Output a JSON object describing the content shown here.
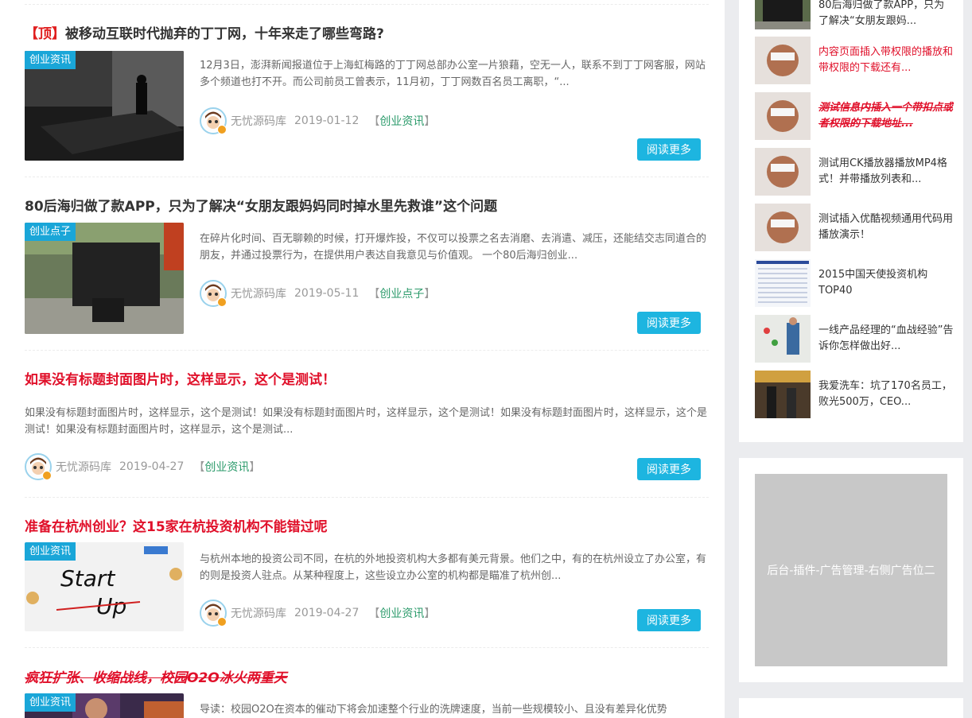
{
  "posts": [
    {
      "title_prefix": "【顶】",
      "title": "被移动互联时代抛弃的丁丁网，十年来走了哪些弯路?",
      "badge": "创业资讯",
      "excerpt": "12月3日，澎湃新闻报道位于上海虹梅路的丁丁网总部办公室一片狼藉，空无一人，联系不到丁丁网客服，网站多个频道也打不开。而公司前员工曾表示，11月初，丁丁网数百名员工离职，“...",
      "author": "无忧源码库",
      "date": "2019-01-12",
      "category_open": "【",
      "category": "创业资讯",
      "category_close": "】",
      "more": "阅读更多"
    },
    {
      "title": "80后海归做了款APP，只为了解决“女朋友跟妈妈同时掉水里先救谁”这个问题",
      "badge": "创业点子",
      "excerpt": "在碎片化时间、百无聊赖的时候，打开爆炸投，不仅可以投票之名去消磨、去消遣、减压，还能结交志同道合的朋友，并通过投票行为，在提供用户表达自我意见与价值观。 一个80后海归创业...",
      "author": "无忧源码库",
      "date": "2019-05-11",
      "category_open": "【",
      "category": "创业点子",
      "category_close": "】",
      "more": "阅读更多"
    },
    {
      "title": "如果没有标题封面图片时，这样显示，这个是测试！",
      "excerpt": "如果没有标题封面图片时，这样显示，这个是测试！如果没有标题封面图片时，这样显示，这个是测试！如果没有标题封面图片时，这样显示，这个是测试！如果没有标题封面图片时，这样显示，这个是测试...",
      "author": "无忧源码库",
      "date": "2019-04-27",
      "category_open": "【",
      "category": "创业资讯",
      "category_close": "】",
      "more": "阅读更多"
    },
    {
      "title": "准备在杭州创业？这15家在杭投资机构不能错过呢",
      "badge": "创业资讯",
      "excerpt": "与杭州本地的投资公司不同，在杭的外地投资机构大多都有美元背景。他们之中，有的在杭州设立了办公室，有的则是投资人驻点。从某种程度上，这些设立办公室的机构都是瞄准了杭州创...",
      "author": "无忧源码库",
      "date": "2019-04-27",
      "category_open": "【",
      "category": "创业资讯",
      "category_close": "】",
      "more": "阅读更多"
    },
    {
      "title": "疯狂扩张、收缩战线，校园O2O冰火两重天",
      "badge": "创业资讯",
      "excerpt": "导读：校园O2O在资本的催动下将会加速整个行业的洗牌速度，当前一些规模较小、且没有差异化优势"
    }
  ],
  "sidebar": {
    "items": [
      {
        "text": "80后海归做了款APP，只为了解决“女朋友跟妈..."
      },
      {
        "text": "内容页面插入带权限的播放和带权限的下载还有..."
      },
      {
        "text": "测试信息内插入一个带扣点或者权限的下载地址..."
      },
      {
        "text": "测试用CK播放器播放MP4格式！并带播放列表和..."
      },
      {
        "text": "测试插入优酷视频通用代码用播放演示！"
      },
      {
        "text": "2015中国天使投资机构TOP40"
      },
      {
        "text": "一线产品经理的“血战经验”告诉你怎样做出好..."
      },
      {
        "text": "我爱洗车：坑了170名员工，败光500万，CEO..."
      }
    ],
    "ad_text": "后台-插件-广告管理-右侧广告位二"
  },
  "colors": {
    "accent": "#1db5e0",
    "title_red": "#e0102a",
    "category_green": "#2a9a6a"
  }
}
